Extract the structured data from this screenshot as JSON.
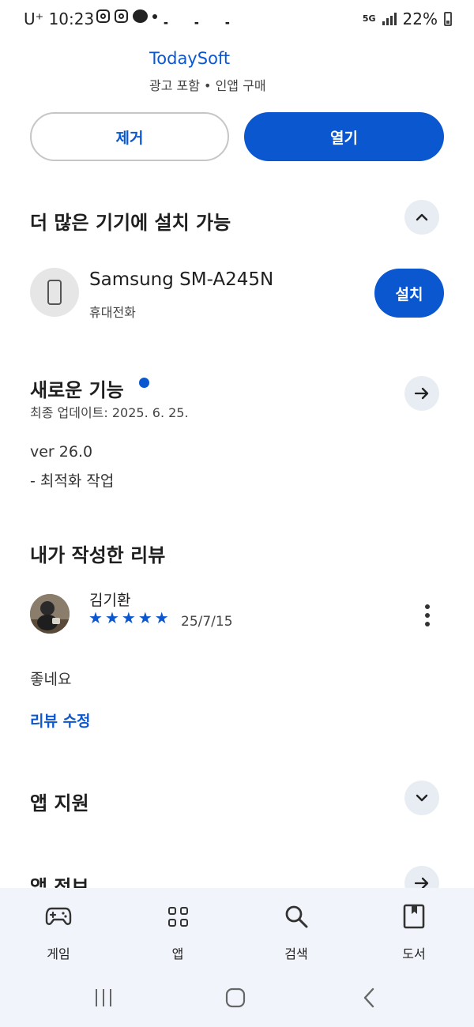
{
  "status_bar": {
    "carrier": "U⁺",
    "time": "10:23",
    "network": "5G",
    "battery": "22%"
  },
  "app_header": {
    "title_fragment": "· · ·",
    "developer": "TodaySoft",
    "subtitle": "광고 포함 • 인앱 구매"
  },
  "actions": {
    "uninstall_label": "제거",
    "open_label": "열기"
  },
  "more_devices": {
    "heading": "더 많은 기기에 설치 가능",
    "device_name": "Samsung SM-A245N",
    "device_type": "휴대전화",
    "install_label": "설치"
  },
  "whats_new": {
    "heading": "새로운 기능",
    "last_updated": "최종 업데이트: 2025. 6. 25.",
    "version": "ver 26.0",
    "notes": "- 최적화 작업"
  },
  "my_review": {
    "heading": "내가 작성한 리뷰",
    "reviewer": "김기환",
    "rating": 5,
    "date": "25/7/15",
    "text": "좋네요",
    "edit_label": "리뷰 수정"
  },
  "app_support": {
    "heading": "앱 지원"
  },
  "app_info": {
    "heading": "앱 정보"
  },
  "bottom_nav": {
    "games": "게임",
    "apps": "앱",
    "search": "검색",
    "books": "도서"
  },
  "colors": {
    "accent": "#0b57d0",
    "round_button_bg": "#e8ecf3",
    "nav_bg": "#f1f4fa"
  }
}
